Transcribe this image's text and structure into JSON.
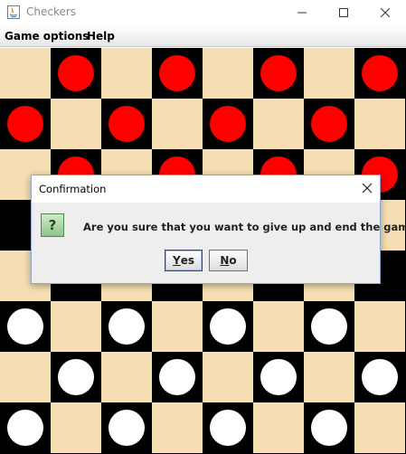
{
  "window": {
    "title": "Checkers",
    "minimize_icon": "minimize-icon",
    "maximize_icon": "maximize-icon",
    "close_icon": "close-icon"
  },
  "menu": {
    "items": [
      {
        "label": "Game options"
      },
      {
        "label": "Help"
      }
    ]
  },
  "board": {
    "rows": 8,
    "cols": 8,
    "light_color": "#f5deb3",
    "dark_color": "#000000",
    "red_piece_color": "#ff0000",
    "white_piece_color": "#ffffff",
    "pieces": [
      {
        "row": 0,
        "col": 1,
        "color": "red"
      },
      {
        "row": 0,
        "col": 3,
        "color": "red"
      },
      {
        "row": 0,
        "col": 5,
        "color": "red"
      },
      {
        "row": 0,
        "col": 7,
        "color": "red"
      },
      {
        "row": 1,
        "col": 0,
        "color": "red"
      },
      {
        "row": 1,
        "col": 2,
        "color": "red"
      },
      {
        "row": 1,
        "col": 4,
        "color": "red"
      },
      {
        "row": 1,
        "col": 6,
        "color": "red"
      },
      {
        "row": 2,
        "col": 1,
        "color": "red"
      },
      {
        "row": 2,
        "col": 3,
        "color": "red"
      },
      {
        "row": 2,
        "col": 5,
        "color": "red"
      },
      {
        "row": 2,
        "col": 7,
        "color": "red"
      },
      {
        "row": 5,
        "col": 0,
        "color": "white"
      },
      {
        "row": 5,
        "col": 2,
        "color": "white"
      },
      {
        "row": 5,
        "col": 4,
        "color": "white"
      },
      {
        "row": 5,
        "col": 6,
        "color": "white"
      },
      {
        "row": 6,
        "col": 1,
        "color": "white"
      },
      {
        "row": 6,
        "col": 3,
        "color": "white"
      },
      {
        "row": 6,
        "col": 5,
        "color": "white"
      },
      {
        "row": 6,
        "col": 7,
        "color": "white"
      },
      {
        "row": 7,
        "col": 0,
        "color": "white"
      },
      {
        "row": 7,
        "col": 2,
        "color": "white"
      },
      {
        "row": 7,
        "col": 4,
        "color": "white"
      },
      {
        "row": 7,
        "col": 6,
        "color": "white"
      }
    ]
  },
  "dialog": {
    "title": "Confirmation",
    "message": "Are you sure that you want to give up and end the game?",
    "icon": "question-icon",
    "icon_glyph": "?",
    "yes_mnemonic": "Y",
    "yes_rest": "es",
    "no_mnemonic": "N",
    "no_rest": "o"
  }
}
